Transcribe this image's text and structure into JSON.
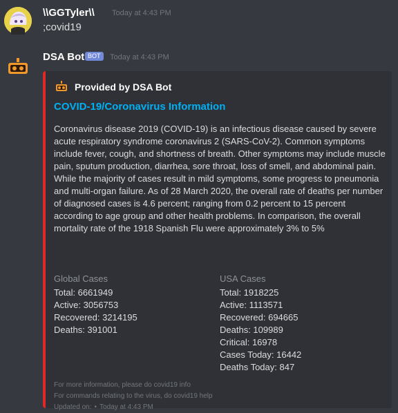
{
  "messages": {
    "user": {
      "username": "\\\\GGTyler\\\\",
      "timestamp": "Today at 4:43 PM",
      "text": ";covid19"
    },
    "bot": {
      "username": "DSA Bot",
      "badge": "BOT",
      "timestamp": "Today at 4:43 PM"
    }
  },
  "embed": {
    "accent_color": "#e02828",
    "author": "Provided by DSA Bot",
    "title": "COVID-19/Coronavirus Information",
    "description": "Coronavirus disease 2019 (COVID-19) is an infectious disease caused by severe acute respiratory syndrome coronavirus 2 (SARS-CoV-2). Common symptoms include fever, cough, and shortness of breath. Other symptoms may include muscle pain, sputum production, diarrhea, sore throat, loss of smell, and abdominal pain. While the majority of cases result in mild symptoms, some progress to pneumonia and multi-organ failure. As of 28 March 2020, the overall rate of deaths per number of diagnosed cases is 4.6 percent; ranging from 0.2 percent to 15 percent according to age group and other health problems. In comparison, the overall mortality rate of the 1918 Spanish Flu were approximately 3% to 5%",
    "fields": [
      {
        "name": "Global Cases",
        "lines": [
          "Total: 6661949",
          "Active: 3056753",
          "Recovered: 3214195",
          "Deaths: 391001"
        ]
      },
      {
        "name": "USA Cases",
        "lines": [
          "Total: 1918225",
          "Active: 1113571",
          "Recovered: 694665",
          "Deaths: 109989",
          "Critical: 16978",
          "Cases Today: 16442",
          "Deaths Today: 847"
        ]
      }
    ],
    "footer": {
      "line1": "For more information, please do covid19 info",
      "line2": "For commands relating to the virus, do covid19 help",
      "line3": "Updated on:",
      "separator": "•",
      "timestamp": "Today at 4:43 PM"
    }
  },
  "icons": {
    "user_avatar": "anime-character-avatar",
    "bot_avatar": "robot-icon",
    "author_icon": "robot-icon"
  }
}
